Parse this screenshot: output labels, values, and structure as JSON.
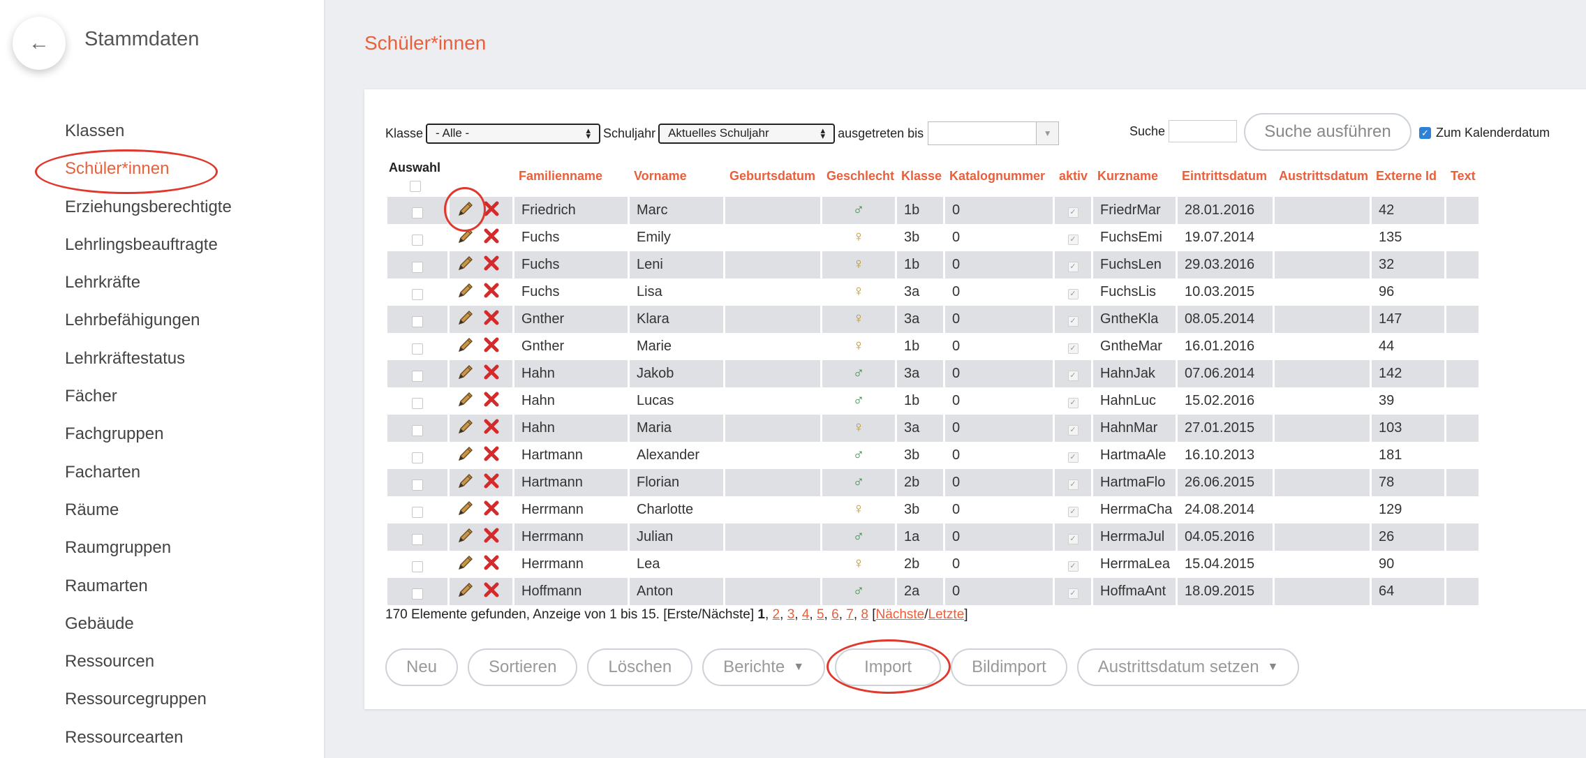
{
  "sidebar": {
    "back_icon": "←",
    "title": "Stammdaten",
    "items": [
      {
        "label": "Klassen"
      },
      {
        "label": "Schüler*innen",
        "active": true
      },
      {
        "label": "Erziehungsberechtigte"
      },
      {
        "label": "Lehrlingsbeauftragte"
      },
      {
        "label": "Lehrkräfte"
      },
      {
        "label": "Lehrbefähigungen"
      },
      {
        "label": "Lehrkräftestatus"
      },
      {
        "label": "Fächer"
      },
      {
        "label": "Fachgruppen"
      },
      {
        "label": "Facharten"
      },
      {
        "label": "Räume"
      },
      {
        "label": "Raumgruppen"
      },
      {
        "label": "Raumarten"
      },
      {
        "label": "Gebäude"
      },
      {
        "label": "Ressourcen"
      },
      {
        "label": "Ressourcegruppen"
      },
      {
        "label": "Ressourcearten"
      }
    ]
  },
  "page": {
    "title": "Schüler*innen"
  },
  "filters": {
    "klasse_label": "Klasse",
    "klasse_value": "- Alle -",
    "schuljahr_label": "Schuljahr",
    "schuljahr_value": "Aktuelles Schuljahr",
    "ausgetreten_label": "ausgetreten bis",
    "ausgetreten_value": "",
    "suche_label": "Suche",
    "suche_value": "",
    "suche_button": "Suche ausführen",
    "kalender_label": "Zum Kalenderdatum",
    "kalender_checked": true
  },
  "table": {
    "select_header": "Auswahl",
    "columns": [
      "Familienname",
      "Vorname",
      "Geburtsdatum",
      "Geschlecht",
      "Klasse",
      "Katalognummer",
      "aktiv",
      "Kurzname",
      "Eintrittsdatum",
      "Austrittsdatum",
      "Externe Id",
      "Text"
    ],
    "rows": [
      {
        "familienname": "Friedrich",
        "vorname": "Marc",
        "geburtsdatum": "",
        "geschlecht": "m",
        "klasse": "1b",
        "katalognummer": "0",
        "kurzname": "FriedrMar",
        "eintrittsdatum": "28.01.2016",
        "austrittsdatum": "",
        "externe_id": "42",
        "text": ""
      },
      {
        "familienname": "Fuchs",
        "vorname": "Emily",
        "geburtsdatum": "",
        "geschlecht": "w",
        "klasse": "3b",
        "katalognummer": "0",
        "kurzname": "FuchsEmi",
        "eintrittsdatum": "19.07.2014",
        "austrittsdatum": "",
        "externe_id": "135",
        "text": ""
      },
      {
        "familienname": "Fuchs",
        "vorname": "Leni",
        "geburtsdatum": "",
        "geschlecht": "w",
        "klasse": "1b",
        "katalognummer": "0",
        "kurzname": "FuchsLen",
        "eintrittsdatum": "29.03.2016",
        "austrittsdatum": "",
        "externe_id": "32",
        "text": ""
      },
      {
        "familienname": "Fuchs",
        "vorname": "Lisa",
        "geburtsdatum": "",
        "geschlecht": "w",
        "klasse": "3a",
        "katalognummer": "0",
        "kurzname": "FuchsLis",
        "eintrittsdatum": "10.03.2015",
        "austrittsdatum": "",
        "externe_id": "96",
        "text": ""
      },
      {
        "familienname": "Gnther",
        "vorname": "Klara",
        "geburtsdatum": "",
        "geschlecht": "w",
        "klasse": "3a",
        "katalognummer": "0",
        "kurzname": "GntheKla",
        "eintrittsdatum": "08.05.2014",
        "austrittsdatum": "",
        "externe_id": "147",
        "text": ""
      },
      {
        "familienname": "Gnther",
        "vorname": "Marie",
        "geburtsdatum": "",
        "geschlecht": "w",
        "klasse": "1b",
        "katalognummer": "0",
        "kurzname": "GntheMar",
        "eintrittsdatum": "16.01.2016",
        "austrittsdatum": "",
        "externe_id": "44",
        "text": ""
      },
      {
        "familienname": "Hahn",
        "vorname": "Jakob",
        "geburtsdatum": "",
        "geschlecht": "m",
        "klasse": "3a",
        "katalognummer": "0",
        "kurzname": "HahnJak",
        "eintrittsdatum": "07.06.2014",
        "austrittsdatum": "",
        "externe_id": "142",
        "text": ""
      },
      {
        "familienname": "Hahn",
        "vorname": "Lucas",
        "geburtsdatum": "",
        "geschlecht": "m",
        "klasse": "1b",
        "katalognummer": "0",
        "kurzname": "HahnLuc",
        "eintrittsdatum": "15.02.2016",
        "austrittsdatum": "",
        "externe_id": "39",
        "text": ""
      },
      {
        "familienname": "Hahn",
        "vorname": "Maria",
        "geburtsdatum": "",
        "geschlecht": "w",
        "klasse": "3a",
        "katalognummer": "0",
        "kurzname": "HahnMar",
        "eintrittsdatum": "27.01.2015",
        "austrittsdatum": "",
        "externe_id": "103",
        "text": ""
      },
      {
        "familienname": "Hartmann",
        "vorname": "Alexander",
        "geburtsdatum": "",
        "geschlecht": "m",
        "klasse": "3b",
        "katalognummer": "0",
        "kurzname": "HartmaAle",
        "eintrittsdatum": "16.10.2013",
        "austrittsdatum": "",
        "externe_id": "181",
        "text": ""
      },
      {
        "familienname": "Hartmann",
        "vorname": "Florian",
        "geburtsdatum": "",
        "geschlecht": "m",
        "klasse": "2b",
        "katalognummer": "0",
        "kurzname": "HartmaFlo",
        "eintrittsdatum": "26.06.2015",
        "austrittsdatum": "",
        "externe_id": "78",
        "text": ""
      },
      {
        "familienname": "Herrmann",
        "vorname": "Charlotte",
        "geburtsdatum": "",
        "geschlecht": "w",
        "klasse": "3b",
        "katalognummer": "0",
        "kurzname": "HerrmaCha",
        "eintrittsdatum": "24.08.2014",
        "austrittsdatum": "",
        "externe_id": "129",
        "text": ""
      },
      {
        "familienname": "Herrmann",
        "vorname": "Julian",
        "geburtsdatum": "",
        "geschlecht": "m",
        "klasse": "1a",
        "katalognummer": "0",
        "kurzname": "HerrmaJul",
        "eintrittsdatum": "04.05.2016",
        "austrittsdatum": "",
        "externe_id": "26",
        "text": ""
      },
      {
        "familienname": "Herrmann",
        "vorname": "Lea",
        "geburtsdatum": "",
        "geschlecht": "w",
        "klasse": "2b",
        "katalognummer": "0",
        "kurzname": "HerrmaLea",
        "eintrittsdatum": "15.04.2015",
        "austrittsdatum": "",
        "externe_id": "90",
        "text": ""
      },
      {
        "familienname": "Hoffmann",
        "vorname": "Anton",
        "geburtsdatum": "",
        "geschlecht": "m",
        "klasse": "2a",
        "katalognummer": "0",
        "kurzname": "HoffmaAnt",
        "eintrittsdatum": "18.09.2015",
        "austrittsdatum": "",
        "externe_id": "64",
        "text": ""
      }
    ]
  },
  "pager": {
    "summary": "170 Elemente gefunden, Anzeige von 1 bis 15. [Erste/Nächste]",
    "current": "1",
    "pages": [
      "2",
      "3",
      "4",
      "5",
      "6",
      "7",
      "8"
    ],
    "next": "Nächste",
    "last": "Letzte"
  },
  "buttons": {
    "neu": "Neu",
    "sortieren": "Sortieren",
    "loeschen": "Löschen",
    "berichte": "Berichte",
    "import": "Import",
    "bildimport": "Bildimport",
    "austritt": "Austrittsdatum setzen"
  },
  "icons": {
    "edit": "pencil-icon",
    "delete": "delete-x-icon",
    "male": "male-symbol-icon",
    "female": "female-symbol-icon"
  },
  "colors": {
    "accent": "#e8603c",
    "annotation": "#e0382c",
    "row_stripe": "#dee0e4",
    "checkbox_blue": "#2e82d6"
  }
}
